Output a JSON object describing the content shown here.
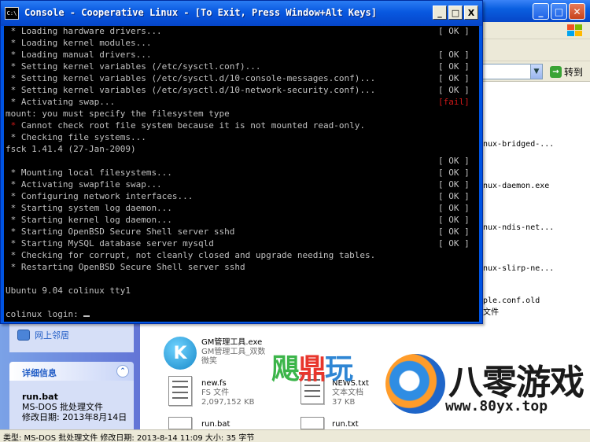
{
  "console": {
    "title": "Console - Cooperative Linux - [To Exit, Press Window+Alt Keys]",
    "icon_text": "C:\\",
    "controls": {
      "minimize": "_",
      "maximize": "□",
      "close": "X"
    },
    "lines": [
      {
        "star": "*",
        "text": "Loading hardware drivers...",
        "status": "[ OK ]"
      },
      {
        "star": "*",
        "text": "Loading kernel modules...",
        "status": ""
      },
      {
        "star": "*",
        "text": "Loading manual drivers...",
        "status": "[ OK ]"
      },
      {
        "star": "*",
        "text": "Setting kernel variables (/etc/sysctl.conf)...",
        "status": "[ OK ]"
      },
      {
        "star": "*",
        "text": "Setting kernel variables (/etc/sysctl.d/10-console-messages.conf)...",
        "status": "[ OK ]"
      },
      {
        "star": "*",
        "text": "Setting kernel variables (/etc/sysctl.d/10-network-security.conf)...",
        "status": "[ OK ]"
      },
      {
        "star": "*",
        "text": "Activating swap...",
        "status": "[fail]"
      },
      {
        "star": "",
        "text": "mount: you must specify the filesystem type",
        "status": ""
      },
      {
        "star": "*",
        "text": "Cannot check root file system because it is not mounted read-only.",
        "status": ""
      },
      {
        "star": "*",
        "text": "Checking file systems...",
        "status": ""
      },
      {
        "star": "",
        "text": "fsck 1.41.4 (27-Jan-2009)",
        "status": ""
      },
      {
        "star": "",
        "text": "",
        "status": "[ OK ]"
      },
      {
        "star": "*",
        "text": "Mounting local filesystems...",
        "status": "[ OK ]"
      },
      {
        "star": "*",
        "text": "Activating swapfile swap...",
        "status": "[ OK ]"
      },
      {
        "star": "*",
        "text": "Configuring network interfaces...",
        "status": "[ OK ]"
      },
      {
        "star": "*",
        "text": "Starting system log daemon...",
        "status": "[ OK ]"
      },
      {
        "star": "*",
        "text": "Starting kernel log daemon...",
        "status": "[ OK ]"
      },
      {
        "star": "*",
        "text": "Starting OpenBSD Secure Shell server sshd",
        "status": "[ OK ]"
      },
      {
        "star": "*",
        "text": "Starting MySQL database server mysqld",
        "status": "[ OK ]"
      },
      {
        "star": "*",
        "text": "Checking for corrupt, not cleanly closed and upgrade needing tables.",
        "status": ""
      },
      {
        "star": "*",
        "text": "Restarting OpenBSD Secure Shell server sshd",
        "status": ""
      },
      {
        "star": "",
        "text": "",
        "status": ""
      },
      {
        "star": "",
        "text": "Ubuntu 9.04 colinux tty1",
        "status": ""
      },
      {
        "star": "",
        "text": "",
        "status": ""
      },
      {
        "star": "",
        "text": "colinux login: ",
        "status": "",
        "cursor": true
      }
    ]
  },
  "explorer": {
    "address_go": "转到",
    "visible_file_texts": [
      "nux-bridged-...",
      "nux-daemon.exe",
      "nux-ndis-net...",
      "nux-slirp-ne...",
      "ple.conf.old",
      "文件"
    ],
    "task_link": "网上邻居",
    "details_title": "详细信息",
    "details": {
      "name": "run.bat",
      "type": "MS-DOS 批处理文件",
      "modified": "修改日期: 2013年8月14日"
    },
    "files": [
      {
        "name": "GM管理工具.exe",
        "sub1": "GM管理工具_双数",
        "sub2": "微笑"
      },
      {
        "name": "new.fs",
        "sub1": "FS 文件",
        "sub2": "2,097,152 KB"
      },
      {
        "name": "NEWS.txt",
        "sub1": "文本文档",
        "sub2": "37 KB"
      },
      {
        "name": "run.bat",
        "sub1": "",
        "sub2": ""
      },
      {
        "name": "run.txt",
        "sub1": "",
        "sub2": ""
      }
    ],
    "status_bar": "类型: MS-DOS 批处理文件 修改日期: 2013-8-14 11:09 大小: 35 字节"
  },
  "watermarks": {
    "left_chars": [
      "飓",
      "鼎",
      "玩"
    ],
    "right_title": "八零游戏",
    "right_url": "www.80yx.top"
  }
}
